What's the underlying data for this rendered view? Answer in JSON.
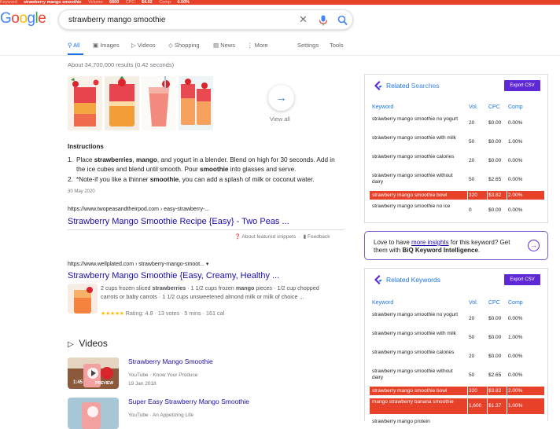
{
  "ext_bar": {
    "keyword_label": "Keyword:",
    "keyword": "strawberry mango smoothie",
    "volume_label": "Volume:",
    "volume": "6600",
    "cpc_label": "CPC:",
    "cpc": "$4.02",
    "comp_label": "Comp:",
    "comp": "0.00%"
  },
  "logo": {
    "text": "Google",
    "colors": [
      "#4285f4",
      "#ea4335",
      "#fbbc05",
      "#4285f4",
      "#34a853",
      "#ea4335"
    ]
  },
  "search": {
    "query": "strawberry mango smoothie",
    "clear_glyph": "✕"
  },
  "nav": {
    "tabs": [
      {
        "label": "All",
        "icon": "search-icon"
      },
      {
        "label": "Images",
        "icon": "image-icon"
      },
      {
        "label": "Videos",
        "icon": "play-icon"
      },
      {
        "label": "Shopping",
        "icon": "tag-icon"
      },
      {
        "label": "News",
        "icon": "news-icon"
      },
      {
        "label": "More",
        "icon": "more-icon"
      }
    ],
    "settings": "Settings",
    "tools": "Tools"
  },
  "result_count": "About 34,700,000 results (0.42 seconds)",
  "images": {
    "view_all": "View all"
  },
  "snippet": {
    "heading": "Instructions",
    "steps": [
      {
        "num": "1.",
        "parts": [
          "Place ",
          "strawberries",
          ", ",
          "mango",
          ", and yogurt in a blender. Blend on high for 30 seconds. Add in the ice cubes and blend until smooth. Pour ",
          "smoothie",
          " into glasses and serve."
        ]
      },
      {
        "num": "2.",
        "parts": [
          "*Note-if you like a thinner ",
          "smoothie",
          ", you can add a splash of milk or coconut water."
        ]
      }
    ],
    "date": "30 May 2020",
    "url": "https://www.twopeasandtheirpod.com › easy-strawberry-...",
    "title": "Strawberry Mango Smoothie Recipe {Easy} - Two Peas ...",
    "about": "About featured snippets",
    "feedback": "Feedback"
  },
  "result2": {
    "url": "https://www.wellplated.com › strawberry-mango-smoot...",
    "title": "Strawberry Mango Smoothie {Easy, Creamy, Healthy ...",
    "snippet_parts": [
      "2 cups frozen sliced ",
      "strawberries",
      " · 1 1/2 cups frozen ",
      "mango",
      " pieces · 1/2 cup chopped carrots or baby carrots · 1 1/2 cups unsweetened almond milk or milk of choice ..."
    ],
    "stars": "★★★★★",
    "rating": "Rating: 4.8 · 13 votes · 5 mins · 161 cal"
  },
  "videos": {
    "heading": "Videos",
    "items": [
      {
        "title": "Strawberry Mango Smoothie",
        "source": "YouTube · Know Your Produce",
        "date": "19 Jan 2018",
        "duration": "1:45",
        "preview": "PREVIEW"
      },
      {
        "title": "Super Easy Strawberry Mango Smoothie",
        "source": "YouTube · An Appetizing Life",
        "date": "",
        "duration": "",
        "preview": ""
      }
    ]
  },
  "related_searches": {
    "title_a": "Related ",
    "title_b": "Searches",
    "export": "Export CSV",
    "headers": [
      "Keyword",
      "Vol.",
      "CPC",
      "Comp"
    ],
    "rows": [
      {
        "kw": "strawberry mango smoothie no yogurt",
        "vol": "20",
        "cpc": "$0.00",
        "comp": "0.00%",
        "hl": false
      },
      {
        "kw": "strawberry mango smoothie with milk",
        "vol": "50",
        "cpc": "$0.00",
        "comp": "1.00%",
        "hl": false
      },
      {
        "kw": "strawberry mango smoothie calories",
        "vol": "20",
        "cpc": "$0.00",
        "comp": "0.00%",
        "hl": false
      },
      {
        "kw": "strawberry mango smoothie without dairy",
        "vol": "50",
        "cpc": "$2.65",
        "comp": "0.00%",
        "hl": false
      },
      {
        "kw": "strawberry mango smoothie bowl",
        "vol": "320",
        "cpc": "$3.82",
        "comp": "2.00%",
        "hl": true
      },
      {
        "kw": "strawberry mango smoothie no ice",
        "vol": "0",
        "cpc": "$0.00",
        "comp": "0.00%",
        "hl": false
      }
    ],
    "highlight_color": "#e8412a"
  },
  "promo": {
    "pre": "Love to have ",
    "link": "more insights",
    "mid": " for this keyword? Get them with ",
    "bold": "BiQ Keyword Intelligence",
    "post": "."
  },
  "related_keywords": {
    "title": "Related Keywords",
    "export": "Export CSV",
    "headers": [
      "Keyword",
      "Vol.",
      "CPC",
      "Comp"
    ],
    "rows": [
      {
        "kw": "strawberry mango smoothie no yogurt",
        "vol": "20",
        "cpc": "$0.00",
        "comp": "0.00%",
        "hl": false
      },
      {
        "kw": "strawberry mango smoothie with milk",
        "vol": "50",
        "cpc": "$0.00",
        "comp": "1.00%",
        "hl": false
      },
      {
        "kw": "strawberry mango smoothie calories",
        "vol": "20",
        "cpc": "$0.00",
        "comp": "0.00%",
        "hl": false
      },
      {
        "kw": "strawberry mango smoothie without dairy",
        "vol": "50",
        "cpc": "$2.65",
        "comp": "0.00%",
        "hl": false
      },
      {
        "kw": "strawberry mango smoothie bowl",
        "vol": "320",
        "cpc": "$3.82",
        "comp": "2.00%",
        "hl": true
      },
      {
        "kw": "mango strawberry banana smoothie",
        "vol": "1,600",
        "cpc": "$1.37",
        "comp": "1.00%",
        "hl": true
      },
      {
        "kw": "strawberry mango protein",
        "vol": "",
        "cpc": "",
        "comp": "",
        "hl": false
      }
    ]
  },
  "accent_color": "#5f28d6",
  "link_color": "#1a0dab"
}
